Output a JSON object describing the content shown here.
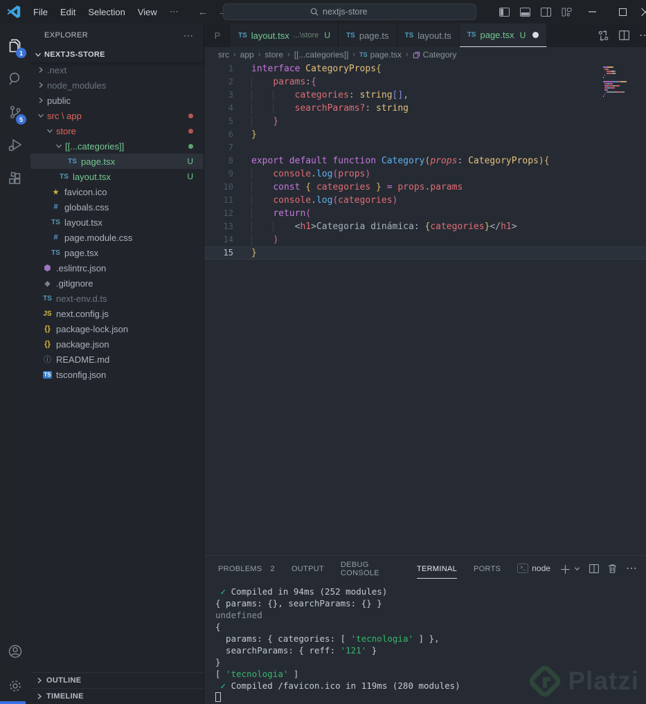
{
  "window": {
    "menus": [
      "File",
      "Edit",
      "Selection",
      "View"
    ],
    "menu_more": "⋯",
    "search_value": "nextjs-store",
    "ghost_tab": "P"
  },
  "activity": {
    "explorer_badge": "1",
    "scm_badge": "5",
    "items": [
      "explorer",
      "search",
      "source-control",
      "run-debug",
      "extensions",
      "account",
      "settings"
    ]
  },
  "explorer": {
    "header": "EXPLORER",
    "header_more": "⋯",
    "project": "NEXTJS-STORE",
    "outline_label": "OUTLINE",
    "timeline_label": "TIMELINE",
    "items": [
      {
        "name": ".next",
        "type": "folder",
        "open": false,
        "indent": 0,
        "color": "dim"
      },
      {
        "name": "node_modules",
        "type": "folder",
        "open": false,
        "indent": 0,
        "color": "dim"
      },
      {
        "name": "public",
        "type": "folder",
        "open": false,
        "indent": 0
      },
      {
        "name": "src \\ app",
        "type": "folder",
        "open": true,
        "indent": 0,
        "color": "red",
        "dot": "red"
      },
      {
        "name": "store",
        "type": "folder",
        "open": true,
        "indent": 1,
        "color": "red",
        "dot": "red"
      },
      {
        "name": "[[...categories]]",
        "type": "folder",
        "open": true,
        "indent": 2,
        "color": "green",
        "dot": "green"
      },
      {
        "name": "page.tsx",
        "type": "file",
        "icon": "ts",
        "indent": 3,
        "color": "green",
        "badge": "U",
        "selected": true
      },
      {
        "name": "layout.tsx",
        "type": "file",
        "icon": "ts",
        "indent": 2,
        "color": "green",
        "badge": "U"
      },
      {
        "name": "favicon.ico",
        "type": "file",
        "icon": "star",
        "indent": 1
      },
      {
        "name": "globals.css",
        "type": "file",
        "icon": "hash",
        "indent": 1
      },
      {
        "name": "layout.tsx",
        "type": "file",
        "icon": "ts",
        "indent": 1
      },
      {
        "name": "page.module.css",
        "type": "file",
        "icon": "hash",
        "indent": 1
      },
      {
        "name": "page.tsx",
        "type": "file",
        "icon": "ts",
        "indent": 1
      },
      {
        "name": ".eslintrc.json",
        "type": "file",
        "icon": "eslint",
        "indent": 0
      },
      {
        "name": ".gitignore",
        "type": "file",
        "icon": "git",
        "indent": 0
      },
      {
        "name": "next-env.d.ts",
        "type": "file",
        "icon": "ts",
        "indent": 0,
        "color": "dim"
      },
      {
        "name": "next.config.js",
        "type": "file",
        "icon": "js",
        "indent": 0
      },
      {
        "name": "package-lock.json",
        "type": "file",
        "icon": "braces",
        "indent": 0
      },
      {
        "name": "package.json",
        "type": "file",
        "icon": "braces",
        "indent": 0
      },
      {
        "name": "README.md",
        "type": "file",
        "icon": "info",
        "indent": 0
      },
      {
        "name": "tsconfig.json",
        "type": "file",
        "icon": "tsconfig",
        "indent": 0
      }
    ]
  },
  "tabs": [
    {
      "title": "layout.tsx",
      "detail": "...\\store",
      "badge": "U",
      "green": true
    },
    {
      "title": "page.ts"
    },
    {
      "title": "layout.ts"
    },
    {
      "title": "page.tsx",
      "badge": "U",
      "dirty": true,
      "green": true,
      "active": true
    }
  ],
  "breadcrumb": [
    {
      "label": "src"
    },
    {
      "label": "app"
    },
    {
      "label": "store"
    },
    {
      "label": "[[...categories]]"
    },
    {
      "label": "page.tsx",
      "icon": "ts"
    },
    {
      "label": "Category",
      "icon": "symbol"
    }
  ],
  "code": {
    "lines": [
      {
        "n": 1,
        "tokens": [
          [
            "interface ",
            "kw"
          ],
          [
            "CategoryProps",
            "type"
          ],
          [
            "{",
            "b1"
          ]
        ]
      },
      {
        "n": 2,
        "tokens": [
          [
            "    ",
            "ind"
          ],
          [
            "params",
            "var"
          ],
          [
            ":",
            "fg"
          ],
          [
            "{",
            "b2"
          ]
        ]
      },
      {
        "n": 3,
        "tokens": [
          [
            "    ",
            "ind"
          ],
          [
            "    ",
            "ind"
          ],
          [
            "categories",
            "var"
          ],
          [
            ": ",
            "fg"
          ],
          [
            "string",
            "type"
          ],
          [
            "[]",
            "b3"
          ],
          [
            ",",
            "fg"
          ]
        ]
      },
      {
        "n": 4,
        "tokens": [
          [
            "    ",
            "ind"
          ],
          [
            "    ",
            "ind"
          ],
          [
            "searchParams?",
            "var"
          ],
          [
            ": ",
            "fg"
          ],
          [
            "string",
            "type"
          ]
        ]
      },
      {
        "n": 5,
        "tokens": [
          [
            "    ",
            "ind"
          ],
          [
            "}",
            "b2"
          ]
        ]
      },
      {
        "n": 6,
        "tokens": [
          [
            "}",
            "b1"
          ]
        ]
      },
      {
        "n": 7,
        "tokens": []
      },
      {
        "n": 8,
        "tokens": [
          [
            "export ",
            "kw"
          ],
          [
            "default ",
            "kw"
          ],
          [
            "function ",
            "kw"
          ],
          [
            "Category",
            "fn"
          ],
          [
            "(",
            "b1"
          ],
          [
            "props",
            "vari"
          ],
          [
            ": ",
            "fg"
          ],
          [
            "CategoryProps",
            "type"
          ],
          [
            "){",
            "b1"
          ]
        ]
      },
      {
        "n": 9,
        "tokens": [
          [
            "    ",
            "ind"
          ],
          [
            "console",
            "var"
          ],
          [
            ".",
            "fg"
          ],
          [
            "log",
            "fn"
          ],
          [
            "(",
            "b2"
          ],
          [
            "props",
            "var"
          ],
          [
            ")",
            "b2"
          ]
        ]
      },
      {
        "n": 10,
        "tokens": [
          [
            "    ",
            "ind"
          ],
          [
            "const ",
            "kw"
          ],
          [
            "{ ",
            "b1"
          ],
          [
            "categories",
            "var"
          ],
          [
            " }",
            "b1"
          ],
          [
            " ",
            "fg"
          ],
          [
            "=",
            "op"
          ],
          [
            " ",
            "fg"
          ],
          [
            "props",
            "var"
          ],
          [
            ".",
            "fg"
          ],
          [
            "params",
            "var"
          ]
        ]
      },
      {
        "n": 11,
        "tokens": [
          [
            "    ",
            "ind"
          ],
          [
            "console",
            "var"
          ],
          [
            ".",
            "fg"
          ],
          [
            "log",
            "fn"
          ],
          [
            "(",
            "b2"
          ],
          [
            "categories",
            "var"
          ],
          [
            ")",
            "b2"
          ]
        ]
      },
      {
        "n": 12,
        "tokens": [
          [
            "    ",
            "ind"
          ],
          [
            "return",
            "kw"
          ],
          [
            "(",
            "b2"
          ]
        ]
      },
      {
        "n": 13,
        "tokens": [
          [
            "    ",
            "ind"
          ],
          [
            "    ",
            "ind"
          ],
          [
            "<",
            "fg"
          ],
          [
            "h1",
            "var"
          ],
          [
            ">",
            "fg"
          ],
          [
            "Categoria dinámica: ",
            "fg"
          ],
          [
            "{",
            "b1"
          ],
          [
            "categories",
            "var"
          ],
          [
            "}",
            "b1"
          ],
          [
            "</",
            "fg"
          ],
          [
            "h1",
            "var"
          ],
          [
            ">",
            "fg"
          ]
        ]
      },
      {
        "n": 14,
        "tokens": [
          [
            "    ",
            "ind"
          ],
          [
            ")",
            "b2"
          ]
        ]
      },
      {
        "n": 15,
        "tokens": [
          [
            "}",
            "b1"
          ]
        ],
        "current": true
      }
    ]
  },
  "panel": {
    "tabs": [
      {
        "label": "PROBLEMS",
        "badge": "2"
      },
      {
        "label": "OUTPUT"
      },
      {
        "label": "DEBUG CONSOLE"
      },
      {
        "label": "TERMINAL",
        "active": true
      },
      {
        "label": "PORTS"
      }
    ],
    "shell": "node"
  },
  "terminal": {
    "lines": [
      [
        [
          " ",
          "t-fg"
        ],
        [
          "✓",
          "t-green"
        ],
        [
          " Compiled in 94ms (252 modules)",
          "t-fg"
        ]
      ],
      [
        [
          "{ params: {}, searchParams: {} }",
          "t-fg"
        ]
      ],
      [
        [
          "undefined",
          "t-dim"
        ]
      ],
      [
        [
          "{",
          "t-fg"
        ]
      ],
      [
        [
          "  params: { categories: [ ",
          "t-fg"
        ],
        [
          "'tecnologia'",
          "t-str"
        ],
        [
          " ] },",
          "t-fg"
        ]
      ],
      [
        [
          "  searchParams: { reff: ",
          "t-fg"
        ],
        [
          "'121'",
          "t-str"
        ],
        [
          " }",
          "t-fg"
        ]
      ],
      [
        [
          "}",
          "t-fg"
        ]
      ],
      [
        [
          "[ ",
          "t-fg"
        ],
        [
          "'tecnologia'",
          "t-str"
        ],
        [
          " ]",
          "t-fg"
        ]
      ],
      [
        [
          " ",
          "t-fg"
        ],
        [
          "✓",
          "t-green"
        ],
        [
          " Compiled /favicon.ico in 119ms (280 modules)",
          "t-fg"
        ]
      ]
    ]
  },
  "watermark": {
    "text": "Platzi"
  },
  "colors": {
    "accent_badge": "#3a71d6",
    "git_untracked_green": "#73c991",
    "error_red": "#e0655c",
    "keyword_purple": "#c678dd",
    "type_yellow": "#e5c07b",
    "variable_red": "#e06c75",
    "function_blue": "#61afef",
    "bracket_gold": "#d7ba6a",
    "bracket_pink": "#d068a8",
    "terminal_green": "#23c98a",
    "string_green": "#37b86b",
    "editor_bg": "#262b33",
    "sidebar_bg": "#21252b",
    "titlebar_bg": "#1e2227"
  }
}
